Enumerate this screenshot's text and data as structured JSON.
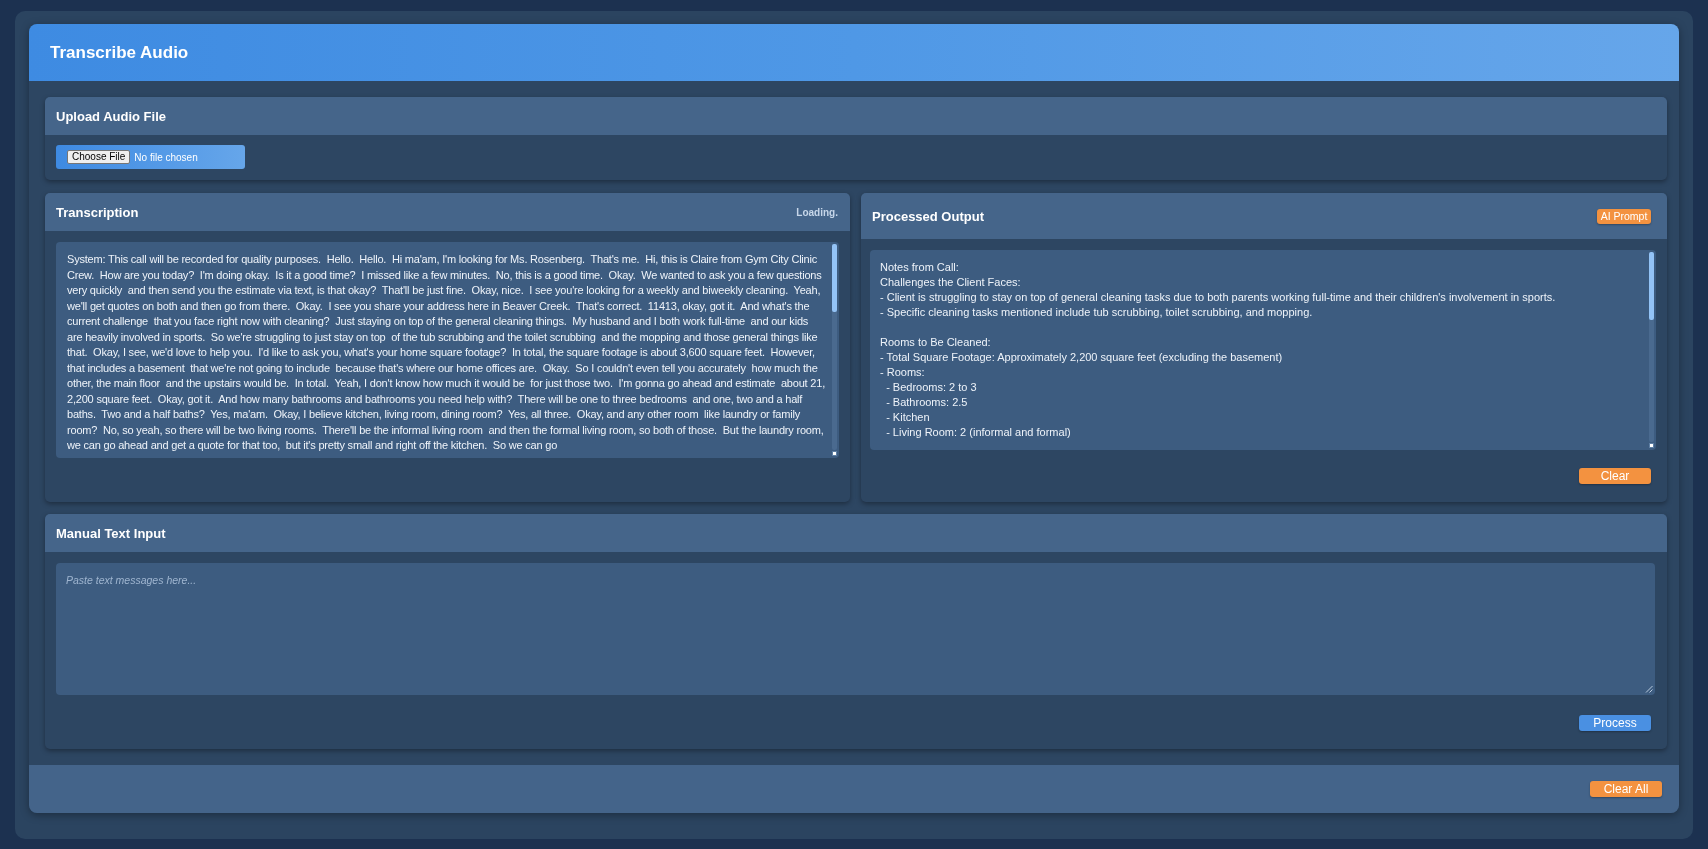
{
  "app": {
    "title": "Transcribe Audio"
  },
  "upload": {
    "title": "Upload Audio File",
    "button": "Choose File",
    "status": "No file chosen"
  },
  "transcription": {
    "title": "Transcription",
    "status": "Loading.",
    "text": "System: This call will be recorded for quality purposes.  Hello.  Hello.  Hi ma'am, I'm looking for Ms. Rosenberg.  That's me.  Hi, this is Claire from Gym City Clinic Crew.  How are you today?  I'm doing okay.  Is it a good time?  I missed like a few minutes.  No, this is a good time.  Okay.  We wanted to ask you a few questions very quickly  and then send you the estimate via text, is that okay?  That'll be just fine.  Okay, nice.  I see you're looking for a weekly and biweekly cleaning.  Yeah, we'll get quotes on both and then go from there.  Okay.  I see you share your address here in Beaver Creek.  That's correct.  11413, okay, got it.  And what's the current challenge  that you face right now with cleaning?  Just staying on top of the general cleaning things.  My husband and I both work full-time  and our kids are heavily involved in sports.  So we're struggling to just stay on top  of the tub scrubbing and the toilet scrubbing  and the mopping and those general things like that.  Okay, I see, we'd love to help you.  I'd like to ask you, what's your home square footage?  In total, the square footage is about 3,600 square feet.  However, that includes a basement  that we're not going to include  because that's where our home offices are.  Okay.  So I couldn't even tell you accurately  how much the other, the main floor  and the upstairs would be.  In total.  Yeah, I don't know how much it would be  for just those two.  I'm gonna go ahead and estimate  about 21, 2,200 square feet.  Okay, got it.  And how many bathrooms and bathrooms you need help with?  There will be one to three bedrooms  and one, two and a half baths.  Two and a half baths?  Yes, ma'am.  Okay, I believe kitchen, living room, dining room?  Yes, all three.  Okay, and any other room  like laundry or family room?  No, so yeah, so there will be two living rooms.  There'll be the informal living room  and then the formal living room, so both of those.  But the laundry room,  we can go ahead and get a quote for that too,  but it's pretty small and right off the kitchen.  So we can go"
  },
  "processed_output": {
    "title": "Processed Output",
    "badge": "AI Prompt",
    "text": "Notes from Call:\nChallenges the Client Faces:\n- Client is struggling to stay on top of general cleaning tasks due to both parents working full-time and their children's involvement in sports.\n- Specific cleaning tasks mentioned include tub scrubbing, toilet scrubbing, and mopping.\n\nRooms to Be Cleaned:\n- Total Square Footage: Approximately 2,200 square feet (excluding the basement)\n- Rooms:\n  - Bedrooms: 2 to 3\n  - Bathrooms: 2.5\n  - Kitchen\n  - Living Room: 2 (informal and formal)",
    "button": "Clear"
  },
  "manual_input": {
    "title": "Manual Text Input",
    "placeholder": "Paste text messages here...",
    "button": "Process"
  },
  "footer": {
    "button": "Clear All"
  }
}
